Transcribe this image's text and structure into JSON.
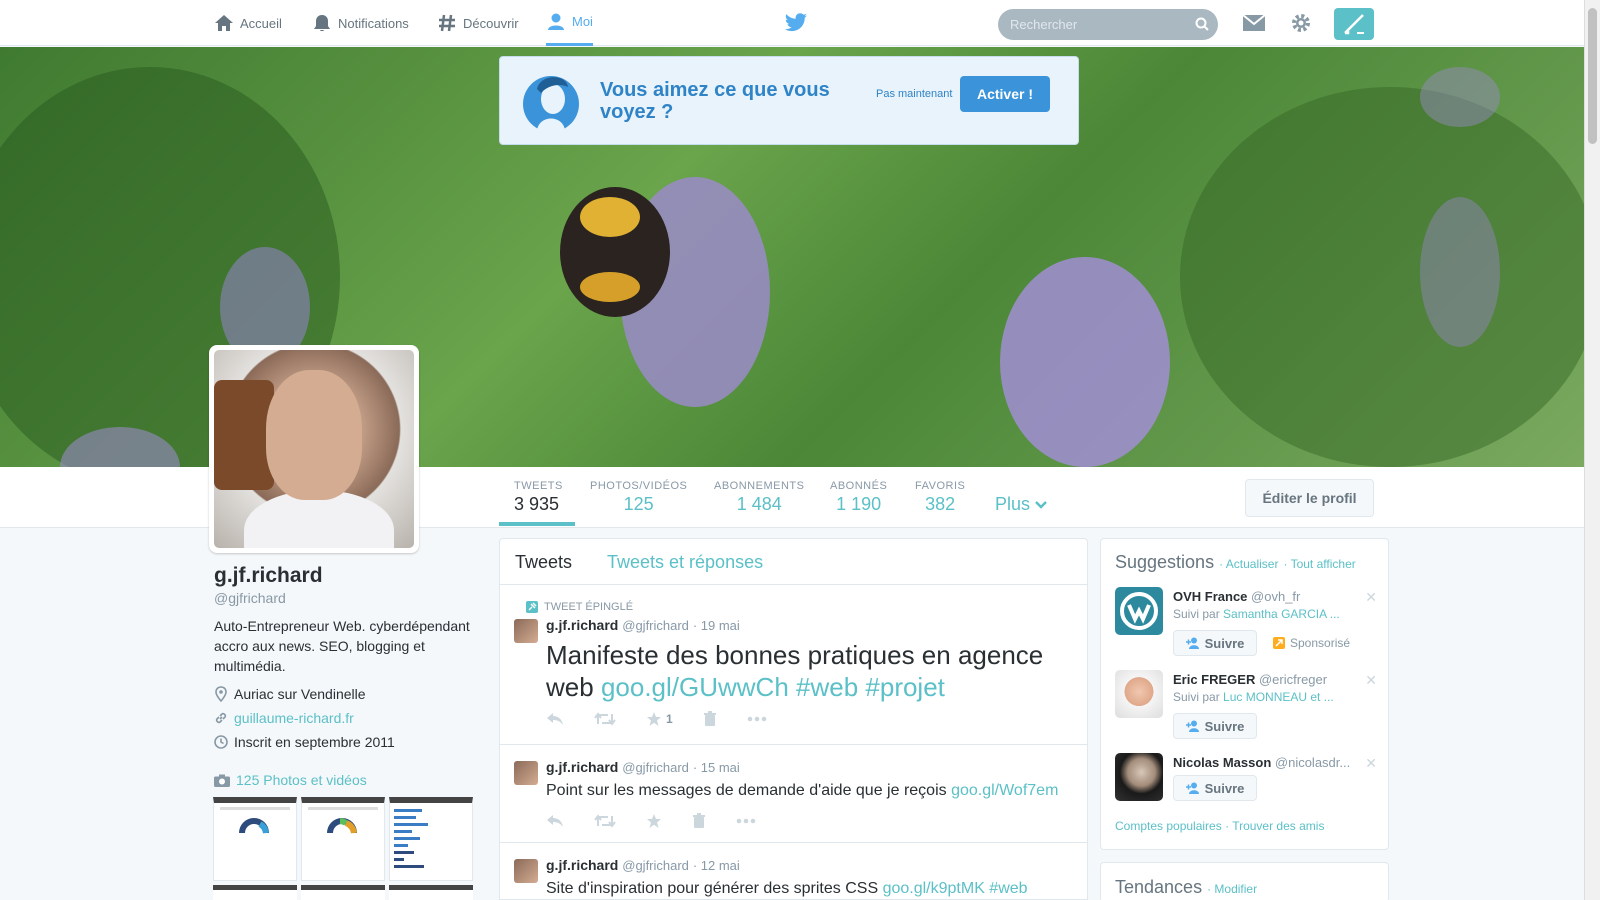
{
  "nav": {
    "home": "Accueil",
    "notifications": "Notifications",
    "discover": "Découvrir",
    "me": "Moi"
  },
  "search": {
    "placeholder": "Rechercher"
  },
  "banner": {
    "title": "Vous aimez ce que vous voyez ?",
    "later": "Pas maintenant",
    "activate": "Activer !"
  },
  "stats": [
    {
      "label": "TWEETS",
      "value": "3 935"
    },
    {
      "label": "PHOTOS/VIDÉOS",
      "value": "125"
    },
    {
      "label": "ABONNEMENTS",
      "value": "1 484"
    },
    {
      "label": "ABONNÉS",
      "value": "1 190"
    },
    {
      "label": "FAVORIS",
      "value": "382"
    }
  ],
  "more": "Plus",
  "edit_profile": "Éditer le profil",
  "profile": {
    "name": "g.jf.richard",
    "handle": "@gjfrichard",
    "bio": "Auto-Entrepreneur Web. cyberdépendant accro aux news. SEO, blogging et multimédia.",
    "location": "Auriac sur Vendinelle",
    "website": "guillaume-richard.fr",
    "joined": "Inscrit en septembre 2011",
    "photos": "125 Photos et vidéos"
  },
  "tabs": {
    "tweets": "Tweets",
    "replies": "Tweets et réponses"
  },
  "tweets": [
    {
      "pinned": "TWEET ÉPINGLÉ",
      "name": "g.jf.richard",
      "handle": "@gjfrichard",
      "date": "· 19 mai",
      "text": "Manifeste des bonnes pratiques en agence web",
      "links": "goo.gl/GUwwCh #web #projet",
      "favs": "1"
    },
    {
      "name": "g.jf.richard",
      "handle": "@gjfrichard",
      "date": "· 15 mai",
      "text": "Point sur les messages de demande d'aide que je reçois",
      "links": "goo.gl/Wof7em"
    },
    {
      "name": "g.jf.richard",
      "handle": "@gjfrichard",
      "date": "· 12 mai",
      "text": "Site d'inspiration pour générer des sprites CSS",
      "links": "goo.gl/k9ptMK #web"
    }
  ],
  "suggestions": {
    "title": "Suggestions",
    "refresh": "· Actualiser",
    "view_all": "· Tout afficher",
    "follow": "Suivre",
    "sponsored": "Sponsorisé",
    "items": [
      {
        "name": "OVH France",
        "handle": "@ovh_fr",
        "followed_prefix": "Suivi par",
        "followed_by": "Samantha GARCIA ..."
      },
      {
        "name": "Eric FREGER",
        "handle": "@ericfreger",
        "followed_prefix": "Suivi par",
        "followed_by": "Luc MONNEAU et ..."
      },
      {
        "name": "Nicolas Masson",
        "handle": "@nicolasdr..."
      }
    ],
    "popular": "Comptes populaires",
    "find_friends": "· Trouver des amis"
  },
  "trends": {
    "title": "Tendances",
    "edit": "· Modifier"
  },
  "colors": {
    "accent": "#5bc0c7",
    "twitter_blue": "#55acee",
    "banner_blue": "#3b94d9"
  }
}
